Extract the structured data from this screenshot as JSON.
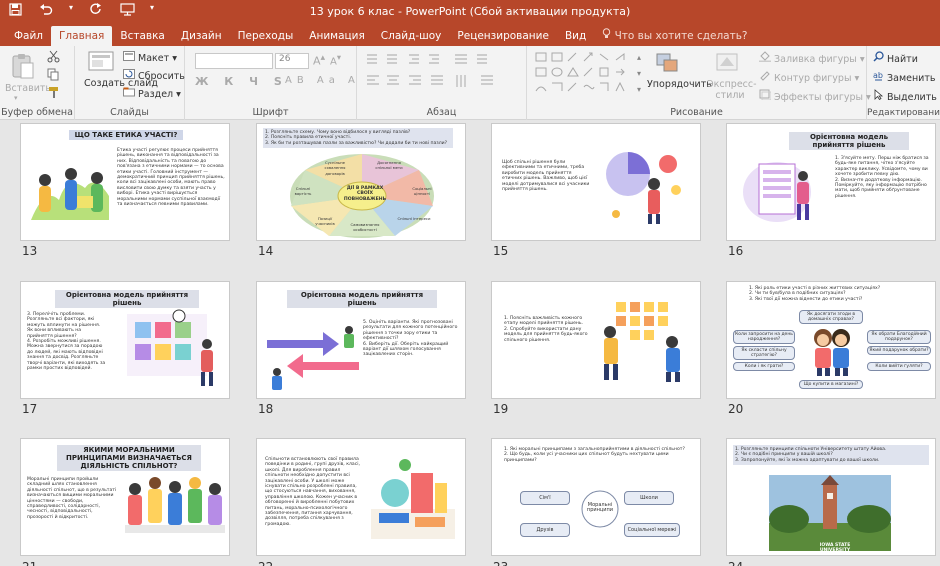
{
  "titlebar": {
    "title": "13 урок 6 клас - PowerPoint (Сбой активации продукта)"
  },
  "tabs": [
    "Файл",
    "Главная",
    "Вставка",
    "Дизайн",
    "Переходы",
    "Анимация",
    "Слайд-шоу",
    "Рецензирование",
    "Вид"
  ],
  "search_hint": "Что вы хотите сделать?",
  "ribbon": {
    "paste": "Вставить",
    "clipboard": "Буфер обмена",
    "create_slide": "Создать слайд",
    "layout": "Макет",
    "reset": "Сбросить",
    "section": "Раздел",
    "slides": "Слайды",
    "font_size": "26",
    "font": "Шрифт",
    "paragraph": "Абзац",
    "arrange": "Упорядочить",
    "quick_styles": "Экспресс-стили",
    "fill": "Заливка фигуры",
    "outline": "Контур фигуры",
    "effects": "Эффекты фигуры",
    "drawing": "Рисование",
    "find": "Найти",
    "replace": "Заменить",
    "select": "Выделить",
    "editing": "Редактирование"
  },
  "slides": [
    {
      "n": "13",
      "title": "ЩО ТАКЕ ЕТИКА УЧАСТІ?",
      "text": "Етика участі регулює процеси прийняття рішень, виконання та відповідальності за них. Відповідальність та повагою до пов'язана з етичними нормами — то основа етики участі. Головний інструмент — демократичний принцип прийняття рішень, коли всі зацікавлені особи, мають право висловити свою думку та взяти участь у виборі. Етика участі вирішується моральними нормами суспільної взаємодії та визначається певними правилами."
    },
    {
      "n": "14",
      "text": "1. Розгляньте схему. Чому воно відбилося у вигляді пазлів?\n2. Поясніть правила етичної участі.\n3. Як би ти розташував пазли за важливістю? Чи додали би ти нові пазли?",
      "center": "ДІЇ В РАМКАХ СВОЇХ ПОВНОВАЖЕНЬ",
      "pieces": [
        "Суспільне схвалення договорів",
        "Досягнення спільної мети",
        "Соціальні цінності",
        "Спільні інтереси",
        "Самовизнання особистості",
        "Позиції учасників",
        "Спільні вартість",
        "Оцінка"
      ]
    },
    {
      "n": "15",
      "text": "Щоб спільні рішення були ефективними та етичними, треба виробити модель прийняття етичних рішень. Важливо, щоб цієї моделі дотримувалися всі учасники прийняття рішень."
    },
    {
      "n": "16",
      "title": "Орієнтовна модель прийняття рішень",
      "text": "1. З'ясуйте мету. Перш ніж братися за будь-яке питання, чітко з'ясуйте характер виклику. Усвідомте, чому ви хочете зробити певну дію.\n2. Визначте додаткову інформацію. Поміркуйте, яку інформацію потрібно мати, щоб прийняти обґрунтоване рішення."
    },
    {
      "n": "17",
      "title": "Орієнтовна модель прийняття рішень",
      "text": "3. Перелічіть проблеми. Розгляньте всі фактори, які можуть вплинути на рішення. Як вони впливають на прийняття рішення?\n4. Розробіть можливі рішення. Можна звернутися за порадою до людей, які мають відповідні знання та досвід. Розгляньте творчі варіанти, які виходять за рамки простих відповідей."
    },
    {
      "n": "18",
      "title": "Орієнтовна модель прийняття рішень",
      "text": "5. Оцініть варіанти. Які прогнозовані результати для кожного потенційного рішення з точки зору етики та ефективності?\n6. Виберіть дії. Оберіть найкращий варіант дії шляхом голосування зацікавлених сторін."
    },
    {
      "n": "19",
      "text": "1. Поясніть важливість кожного етапу моделі прийняття рішень.\n2. Спробуйте використати дану модель для прийняття будь-якого спільного рішення."
    },
    {
      "n": "20",
      "text": "1. Які роль етики участі в різних життєвих ситуаціях?\n2. Чи ти був/була в подібних ситуаціях?\n3. Які твої дії можна віднести до етики участі?",
      "boxes": [
        "Як досягати згоди в домашніх справах?",
        "Коли запросити на день народження?",
        "Як обрати Благодійний подарунок?",
        "Як скласти спільну стратегію?",
        "Який подарунок обрати?",
        "Коли і як грати?",
        "Коли вийти гуляти?",
        "Що купити в магазині?"
      ]
    },
    {
      "n": "21",
      "title": "ЯКИМИ МОРАЛЬНИМИ ПРИНЦИПАМИ ВИЗНАЧАЄТЬСЯ ДІЯЛЬНІСТЬ СПІЛЬНОТ?",
      "text": "Моральні принципи пройшли складний шлях становлення діяльності спільнот, що в результаті визначаються вищими моральними цінностями — свободи, справедливості, солідарності, чесності, відповідальності, прозорості й відкритості."
    },
    {
      "n": "22",
      "text": "Спільноти встановлюють свої правила поведінки в родині, групі друзів, класі, школі. Для вироблення правил спільноти необхідно допустити всі зацікавлені особи. У школі може існувати спільно розроблені правила, що стосуються навчання, виховання, управління школою. Кожен учасник в обговоренні й виробленні побутових питань, морально-психологічного забезпечення, питання харчування, дозвілля, потреба спілкування з громадою."
    },
    {
      "n": "23",
      "text": "1. Які моральні принципами з загальноприйнятими в діяльності спільнот?\n2. Що будь, коли усі учасники цих спільнот будуть нехтувати цими принципами?",
      "center": "Моральні принципи",
      "boxes": [
        "Сім'ї",
        "Школи",
        "Друзів",
        "Соціальної мережі"
      ]
    },
    {
      "n": "24",
      "text": "1. Розгляньте принципи спільноти Університету штату Айова.\n2. Чи є подібні принципи у вашій школі?\n3. Запропонуйте, які їх можна адаптувати до вашої школи.",
      "caption": "IOWA STATE UNIVERSITY"
    }
  ]
}
